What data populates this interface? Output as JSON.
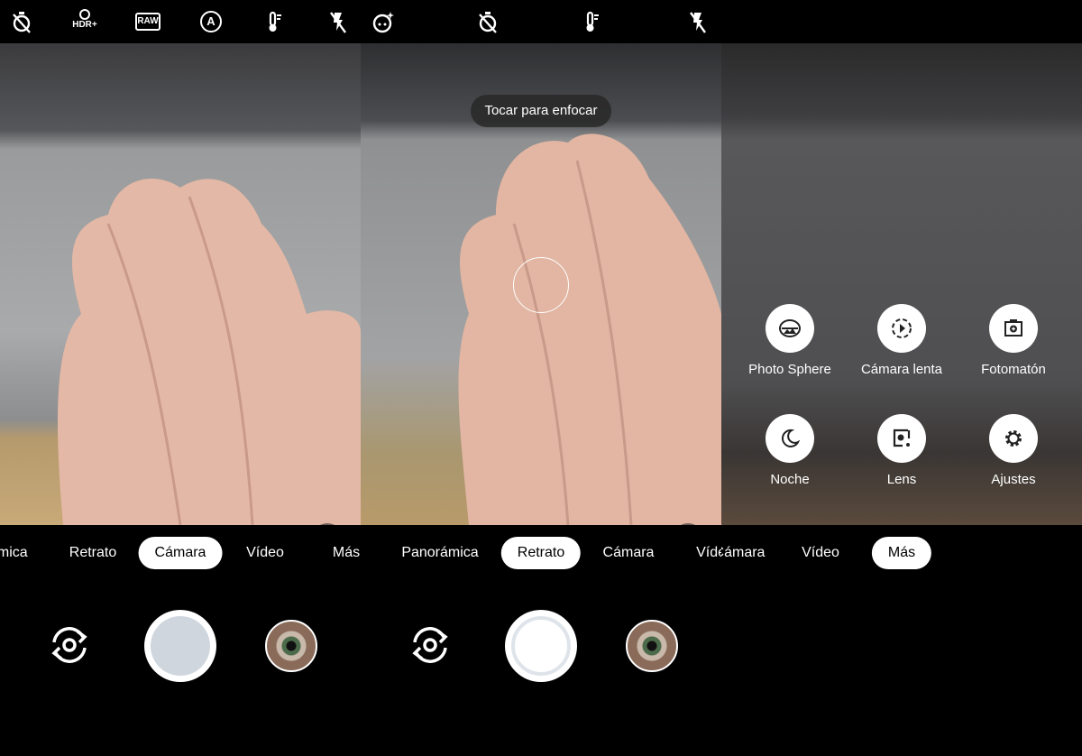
{
  "panels": [
    {
      "top_icons": [
        "timer-off-icon",
        "hdr-plus-icon",
        "raw-icon",
        "auto-exposure-icon",
        "white-balance-icon",
        "flash-off-icon"
      ],
      "hdr_label": "HDR+",
      "raw_label": "RAW",
      "modes": [
        "Panorámica",
        "Retrato",
        "Cámara",
        "Vídeo",
        "Más"
      ],
      "selected": "Cámara"
    },
    {
      "top_icons": [
        "face-retouch-icon",
        "timer-off-icon",
        "white-balance-icon",
        "flash-off-icon"
      ],
      "toast": "Tocar para enfocar",
      "modes": [
        "Panorámica",
        "Retrato",
        "Cámara",
        "Vídeo"
      ],
      "selected": "Retrato"
    },
    {
      "modes": [
        "Cámara",
        "Vídeo",
        "Más"
      ],
      "selected": "Más",
      "menu": [
        {
          "label": "Photo Sphere",
          "icon": "photo-sphere-icon"
        },
        {
          "label": "Cámara lenta",
          "icon": "slow-motion-icon"
        },
        {
          "label": "Fotomatón",
          "icon": "photobooth-icon"
        },
        {
          "label": "Noche",
          "icon": "night-moon-icon"
        },
        {
          "label": "Lens",
          "icon": "lens-icon"
        },
        {
          "label": "Ajustes",
          "icon": "settings-gear-icon"
        }
      ]
    }
  ],
  "colors": {
    "background": "#000000",
    "selected_pill": "#ffffff",
    "shutter_fill": "#cfd6de"
  }
}
